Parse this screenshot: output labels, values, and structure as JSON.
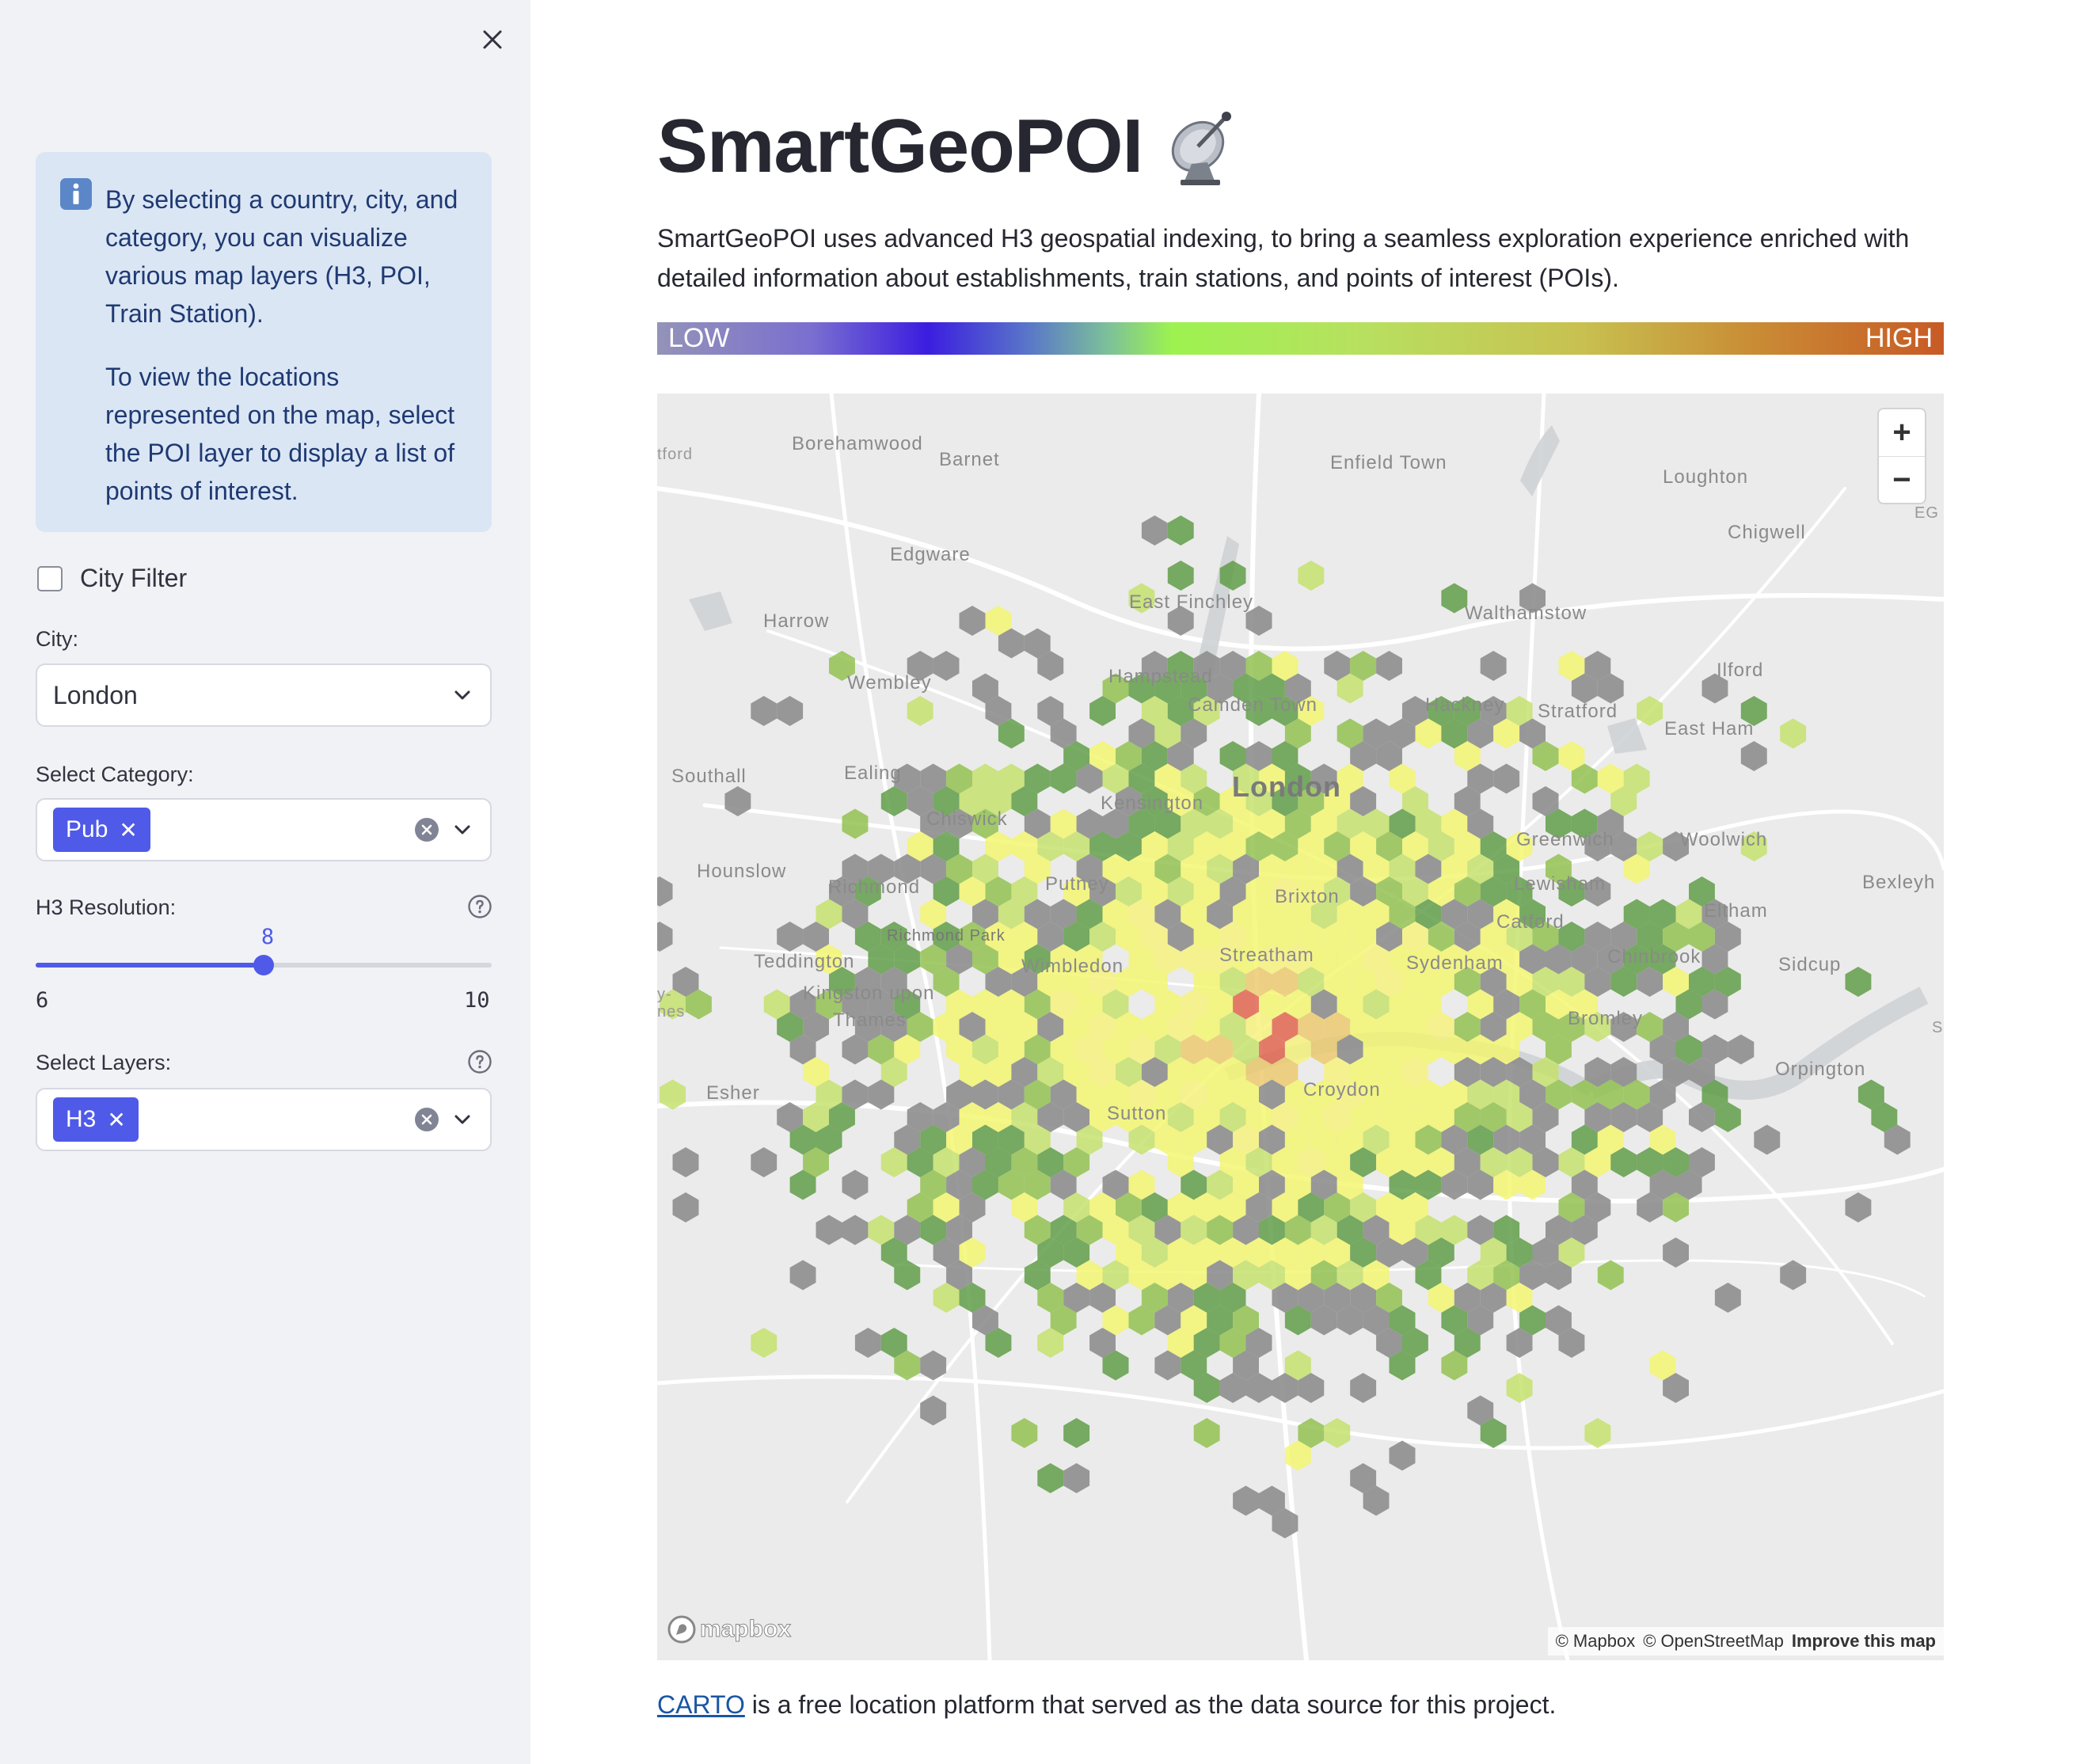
{
  "sidebar": {
    "close_icon": "close-icon",
    "info": {
      "icon": "info-icon",
      "paragraph1": "By selecting a country, city, and category, you can visualize various map layers (H3, POI, Train Station).",
      "paragraph2": "To view the locations represented on the map, select the POI layer to display a list of points of interest."
    },
    "city_filter": {
      "label": "City Filter",
      "checked": false
    },
    "city": {
      "label": "City:",
      "value": "London"
    },
    "category": {
      "label": "Select Category:",
      "tags": [
        "Pub"
      ]
    },
    "h3_resolution": {
      "label": "H3 Resolution:",
      "value": "8",
      "min": "6",
      "max": "10",
      "fraction": 0.5
    },
    "layers": {
      "label": "Select Layers:",
      "tags": [
        "H3"
      ]
    }
  },
  "main": {
    "title": "SmartGeoPOI",
    "title_icon": "satellite-dish-icon",
    "description": "SmartGeoPOI uses advanced H3 geospatial indexing, to bring a seamless exploration experience enriched with detailed information about establishments, train stations, and points of interest (POIs).",
    "legend": {
      "low": "LOW",
      "high": "HIGH"
    },
    "map": {
      "zoom_in": "+",
      "zoom_out": "−",
      "logo": "mapbox",
      "attribution": [
        "© Mapbox",
        "© OpenStreetMap",
        "Improve this map"
      ],
      "places": [
        "Borehamwood",
        "Barnet",
        "Enfield Town",
        "Loughton",
        "Chigwell",
        "Edgware",
        "East Finchley",
        "Walthamstow",
        "Harrow",
        "Hampstead",
        "Ilford",
        "Wembley",
        "Camden Town",
        "Hackney",
        "Stratford",
        "East Ham",
        "Southall",
        "Ealing",
        "London",
        "Kensington",
        "Chiswick",
        "Greenwich",
        "Woolwich",
        "Hounslow",
        "Richmond",
        "Putney",
        "Lewisham",
        "Bexleyh",
        "Brixton",
        "Eltham",
        "Richmond Park",
        "Catford",
        "Teddington",
        "Wimbledon",
        "Streatham",
        "Sydenham",
        "Chinbrook",
        "Sidcup",
        "Kingston upon",
        "Thames",
        "Bromley",
        "Orpington",
        "Esher",
        "Croydon",
        "Sutton",
        "tford",
        "EG",
        "y-",
        "nes",
        "S"
      ]
    },
    "footer": {
      "link": "CARTO",
      "text": " is a free location platform that served as the data source for this project."
    }
  }
}
